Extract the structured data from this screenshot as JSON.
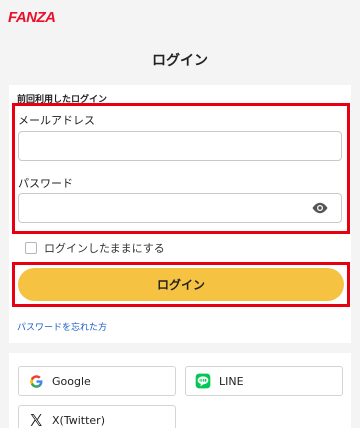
{
  "header": {
    "logo_text": "FANZA"
  },
  "page": {
    "title": "ログイン"
  },
  "form": {
    "previous_login_label": "前回利用したログイン",
    "email_label": "メールアドレス",
    "email_value": "",
    "password_label": "パスワード",
    "password_value": "",
    "remember_label": "ログインしたままにする",
    "remember_checked": false,
    "login_button": "ログイン",
    "forgot_link": "パスワードを忘れた方"
  },
  "social": {
    "buttons": [
      {
        "label": "Google",
        "icon": "google-icon"
      },
      {
        "label": "LINE",
        "icon": "line-icon"
      },
      {
        "label": "X(Twitter)",
        "icon": "x-twitter-icon"
      }
    ]
  },
  "colors": {
    "brand": "#e8102c",
    "highlight_border": "#e60012",
    "login_button": "#f5c242",
    "link": "#1a5dc7",
    "line_green": "#06c755"
  }
}
